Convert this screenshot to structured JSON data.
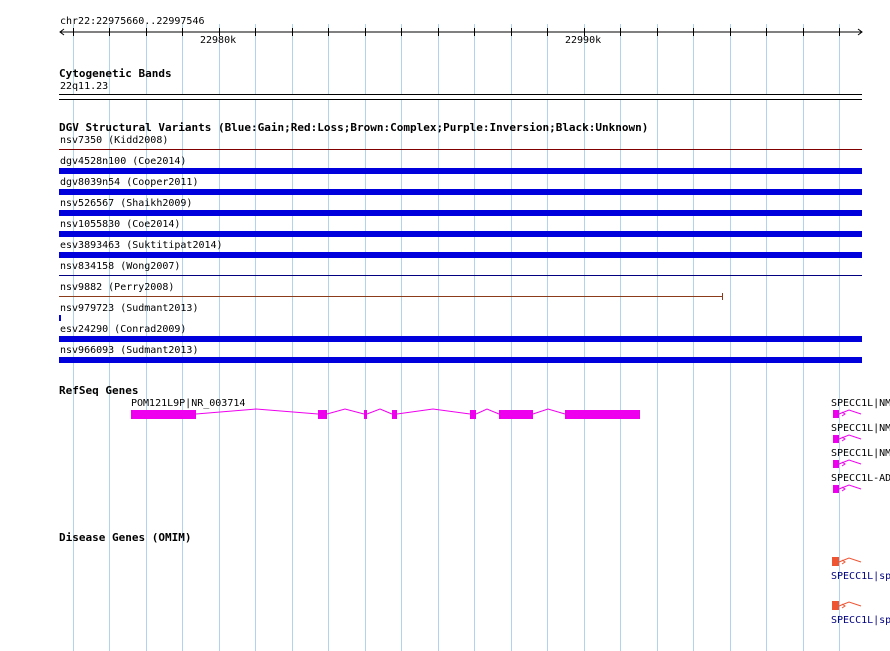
{
  "ruler": {
    "position_label": "chr22:22975660..22997546",
    "tick_labels": [
      "22980k",
      "22990k"
    ]
  },
  "tracks": {
    "cytoband": {
      "title": "Cytogenetic Bands",
      "band": "22q11.23"
    },
    "dgv": {
      "title": "DGV Structural Variants (Blue:Gain;Red:Loss;Brown:Complex;Purple:Inversion;Black:Unknown)",
      "features": [
        {
          "label": "nsv7350 (Kidd2008)",
          "color": "#800000"
        },
        {
          "label": "dgv4528n100 (Coe2014)",
          "color": "#0000dd"
        },
        {
          "label": "dgv8039n54 (Cooper2011)",
          "color": "#0000dd"
        },
        {
          "label": "nsv526567 (Shaikh2009)",
          "color": "#0000dd"
        },
        {
          "label": "nsv1055830 (Coe2014)",
          "color": "#0000dd"
        },
        {
          "label": "esv3893463 (Suktitipat2014)",
          "color": "#0000dd"
        },
        {
          "label": "nsv834158 (Wong2007)",
          "color": "#000080"
        },
        {
          "label": "nsv9882 (Perry2008)",
          "color": "#8b3a1a"
        },
        {
          "label": "nsv979723 (Sudmant2013)",
          "color": "#0000dd"
        },
        {
          "label": "esv24290 (Conrad2009)",
          "color": "#0000dd"
        },
        {
          "label": "nsv966093 (Sudmant2013)",
          "color": "#0000dd"
        }
      ]
    },
    "refseq": {
      "title": "RefSeq Genes",
      "gene_label": "POM121L9P|NR_003714",
      "gene_color": "#ee00ee",
      "right_labels": [
        "SPECC1L|NM",
        "SPECC1L|NM",
        "SPECC1L|NM",
        "SPECC1L-AD"
      ]
    },
    "omim": {
      "title": "Disease Genes (OMIM)",
      "feature_color": "#ee5533",
      "right_labels": [
        "SPECC1L|sp",
        "SPECC1L|sp"
      ]
    }
  }
}
